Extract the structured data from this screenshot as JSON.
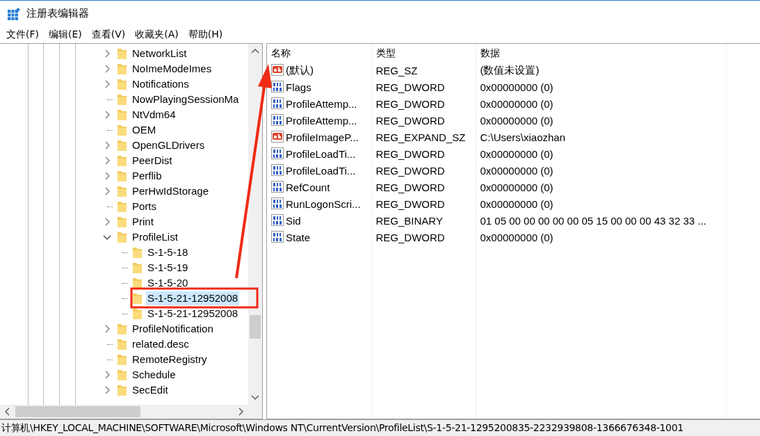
{
  "window": {
    "title": "注册表编辑器"
  },
  "menu": [
    {
      "label": "文件(F)"
    },
    {
      "label": "编辑(E)"
    },
    {
      "label": "查看(V)"
    },
    {
      "label": "收藏夹(A)"
    },
    {
      "label": "帮助(H)"
    }
  ],
  "tree": {
    "items": [
      {
        "kind": "branch",
        "label": "NetworkList",
        "expanded": false,
        "selected": false
      },
      {
        "kind": "branch",
        "label": "NoImeModeImes",
        "expanded": false,
        "selected": false
      },
      {
        "kind": "branch",
        "label": "Notifications",
        "expanded": false,
        "selected": false
      },
      {
        "kind": "leaf",
        "label": "NowPlayingSessionMa",
        "selected": false
      },
      {
        "kind": "branch",
        "label": "NtVdm64",
        "expanded": false,
        "selected": false
      },
      {
        "kind": "leaf",
        "label": "OEM",
        "selected": false
      },
      {
        "kind": "branch",
        "label": "OpenGLDrivers",
        "expanded": false,
        "selected": false
      },
      {
        "kind": "branch",
        "label": "PeerDist",
        "expanded": false,
        "selected": false
      },
      {
        "kind": "branch",
        "label": "Perflib",
        "expanded": false,
        "selected": false
      },
      {
        "kind": "branch",
        "label": "PerHwIdStorage",
        "expanded": false,
        "selected": false
      },
      {
        "kind": "leaf",
        "label": "Ports",
        "selected": false
      },
      {
        "kind": "branch",
        "label": "Print",
        "expanded": false,
        "selected": false
      },
      {
        "kind": "branch",
        "label": "ProfileList",
        "expanded": true,
        "selected": false,
        "children": [
          {
            "kind": "leaf",
            "label": "S-1-5-18",
            "selected": false
          },
          {
            "kind": "leaf",
            "label": "S-1-5-19",
            "selected": false
          },
          {
            "kind": "leaf",
            "label": "S-1-5-20",
            "selected": false
          },
          {
            "kind": "leaf",
            "label": "S-1-5-21-12952008",
            "selected": true
          },
          {
            "kind": "leaf",
            "label": "S-1-5-21-12952008",
            "selected": false
          }
        ]
      },
      {
        "kind": "branch",
        "label": "ProfileNotification",
        "expanded": false,
        "selected": false
      },
      {
        "kind": "leaf",
        "label": "related.desc",
        "selected": false
      },
      {
        "kind": "leaf",
        "label": "RemoteRegistry",
        "selected": false
      },
      {
        "kind": "branch",
        "label": "Schedule",
        "expanded": false,
        "selected": false
      },
      {
        "kind": "branch",
        "label": "SecEdit",
        "expanded": false,
        "selected": false
      }
    ]
  },
  "values": {
    "columns": [
      "名称",
      "类型",
      "数据"
    ],
    "rows": [
      {
        "kind": "string",
        "name": "(默认)",
        "type": "REG_SZ",
        "data": "(数值未设置)"
      },
      {
        "kind": "binary",
        "name": "Flags",
        "type": "REG_DWORD",
        "data": "0x00000000 (0)"
      },
      {
        "kind": "binary",
        "name": "ProfileAttemp...",
        "type": "REG_DWORD",
        "data": "0x00000000 (0)"
      },
      {
        "kind": "binary",
        "name": "ProfileAttemp...",
        "type": "REG_DWORD",
        "data": "0x00000000 (0)"
      },
      {
        "kind": "string",
        "name": "ProfileImageP...",
        "type": "REG_EXPAND_SZ",
        "data": "C:\\Users\\xiaozhan"
      },
      {
        "kind": "binary",
        "name": "ProfileLoadTi...",
        "type": "REG_DWORD",
        "data": "0x00000000 (0)"
      },
      {
        "kind": "binary",
        "name": "ProfileLoadTi...",
        "type": "REG_DWORD",
        "data": "0x00000000 (0)"
      },
      {
        "kind": "binary",
        "name": "RefCount",
        "type": "REG_DWORD",
        "data": "0x00000000 (0)"
      },
      {
        "kind": "binary",
        "name": "RunLogonScri...",
        "type": "REG_DWORD",
        "data": "0x00000000 (0)"
      },
      {
        "kind": "binary",
        "name": "Sid",
        "type": "REG_BINARY",
        "data": "01 05 00 00 00 00 00 05 15 00 00 00 43 32 33 ..."
      },
      {
        "kind": "binary",
        "name": "State",
        "type": "REG_DWORD",
        "data": "0x00000000 (0)"
      }
    ]
  },
  "status_bar": {
    "path": "计算机\\HKEY_LOCAL_MACHINE\\SOFTWARE\\Microsoft\\Windows NT\\CurrentVersion\\ProfileList\\S-1-5-21-1295200835-2232939808-1366676348-1001"
  }
}
